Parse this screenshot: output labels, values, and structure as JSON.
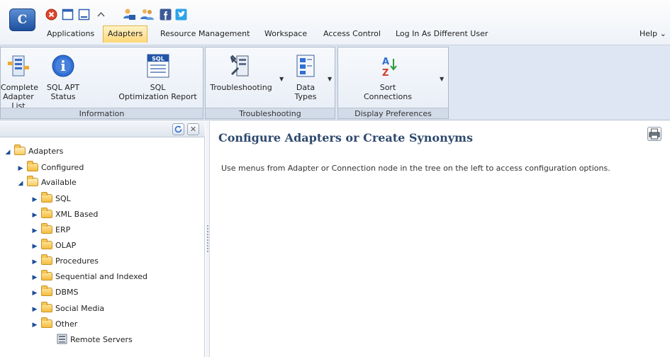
{
  "menu": {
    "items": [
      "Applications",
      "Adapters",
      "Resource Management",
      "Workspace",
      "Access Control",
      "Log In As Different User"
    ],
    "active": "Adapters",
    "help": "Help",
    "help_arrow": "⌄"
  },
  "ribbon": {
    "groups": [
      {
        "label": "Information",
        "buttons": [
          {
            "line1": "Complete",
            "line2": "Adapter List"
          },
          {
            "line1": "SQL APT",
            "line2": "Status"
          },
          {
            "line1": "SQL",
            "line2": "Optimization Report"
          }
        ]
      },
      {
        "label": "Troubleshooting",
        "buttons": [
          {
            "line1": "Troubleshooting",
            "line2": ""
          },
          {
            "line1": "Data",
            "line2": "Types"
          }
        ]
      },
      {
        "label": "Display Preferences",
        "buttons": [
          {
            "line1": "Sort",
            "line2": "Connections"
          }
        ]
      }
    ],
    "sql_badge": "SQL",
    "info_glyph": "i"
  },
  "tree": {
    "root": "Adapters",
    "configured": "Configured",
    "available": "Available",
    "children": [
      "SQL",
      "XML Based",
      "ERP",
      "OLAP",
      "Procedures",
      "Sequential and Indexed",
      "DBMS",
      "Social Media",
      "Other"
    ],
    "remote_servers": "Remote Servers"
  },
  "content": {
    "title": "Configure Adapters or Create Synonyms",
    "text": "Use menus from Adapter or Connection node in the tree on the left to access configuration options."
  },
  "colors": {
    "title_color": "#2f4a6d",
    "active_tab": "#ffd776",
    "ribbon_bg": "#dde6f2"
  }
}
